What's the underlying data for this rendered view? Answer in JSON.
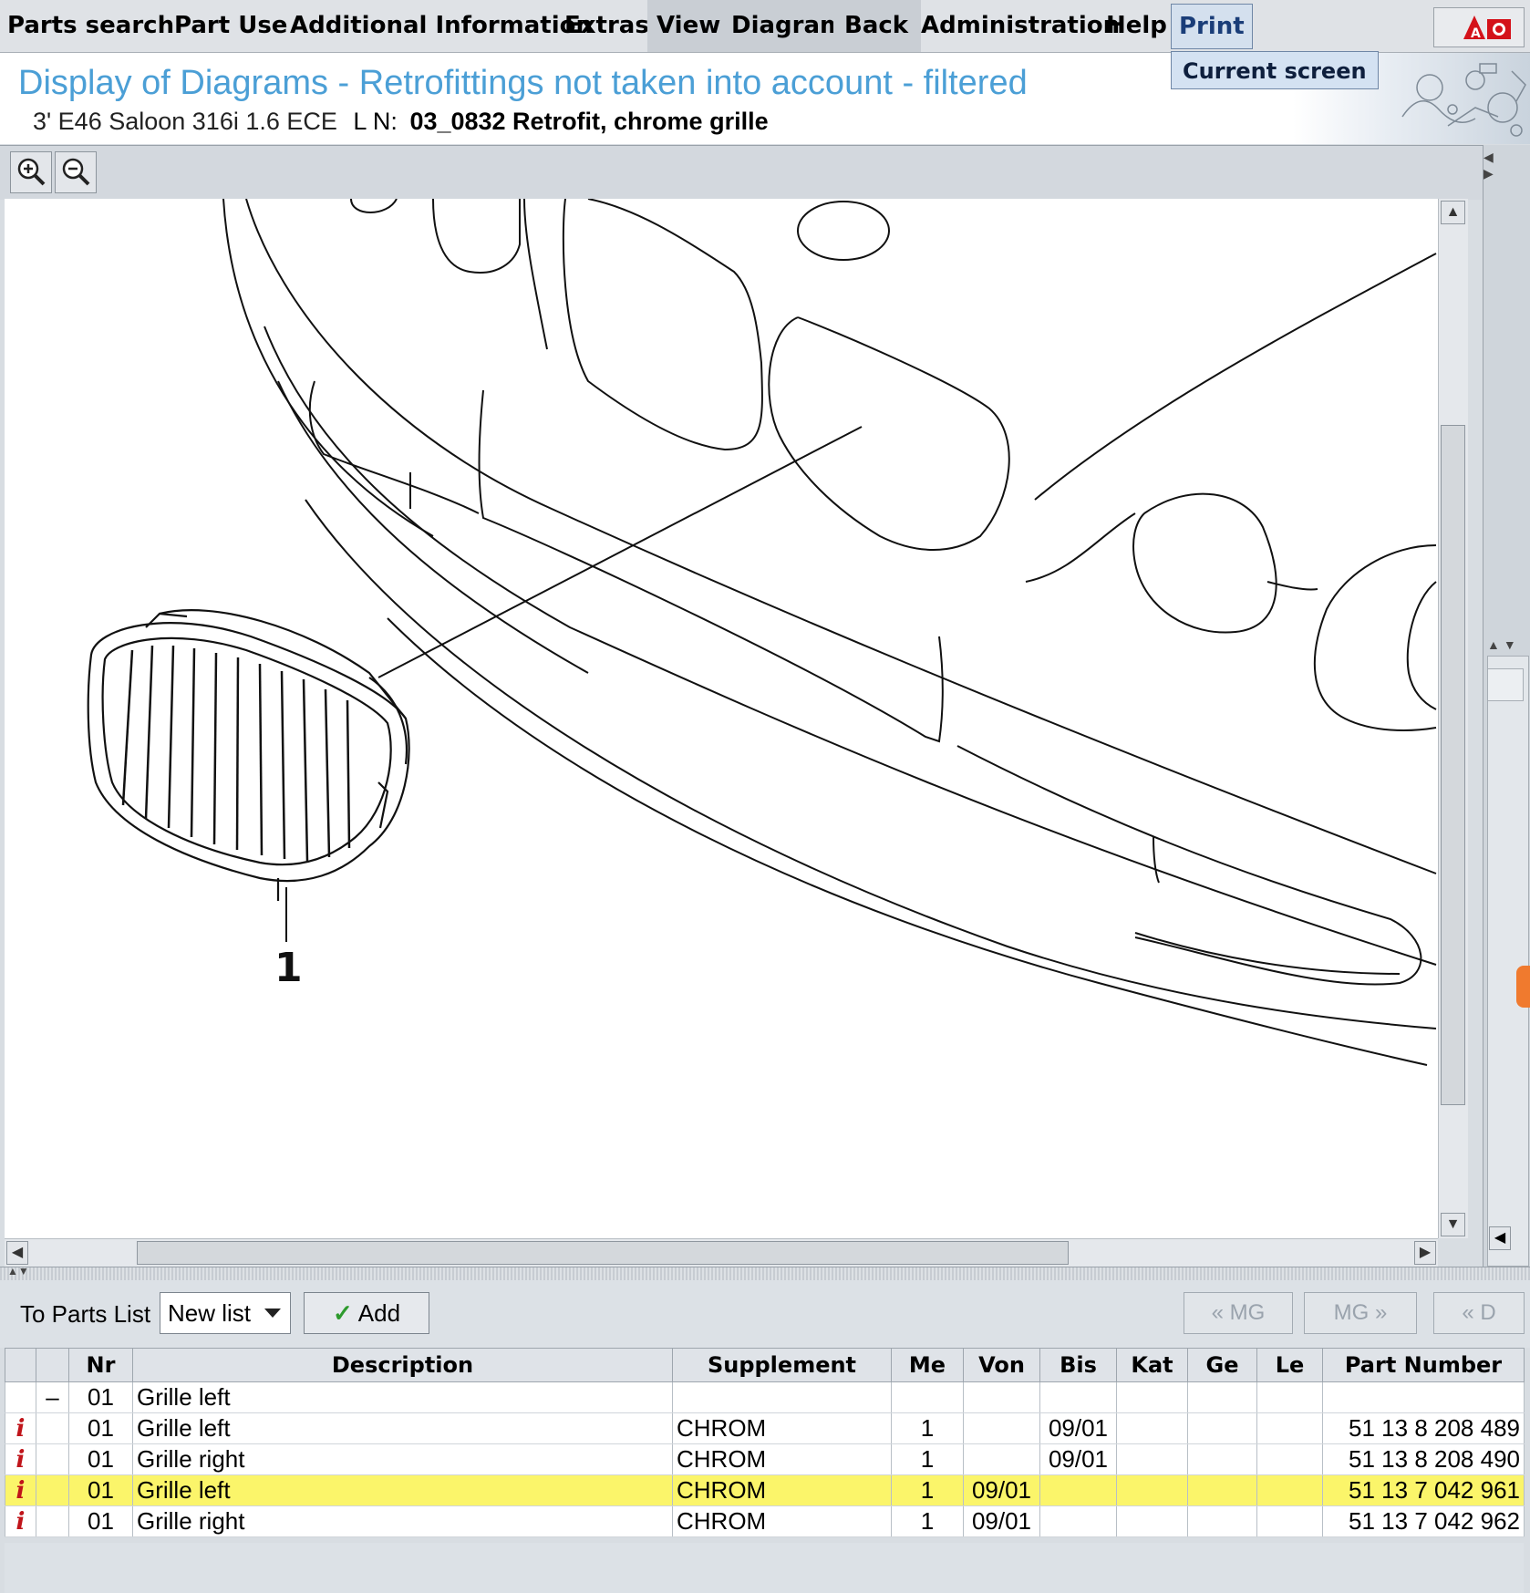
{
  "menu": {
    "items": [
      "Parts search",
      "Part Use",
      "Additional Information",
      "Extras",
      "View",
      "Diagram",
      "Back",
      "Administration",
      "Help",
      "Print"
    ],
    "print_dropdown": "Current screen"
  },
  "header": {
    "title": "Display of Diagrams - Retrofittings not taken into account - filtered",
    "model": "3' E46 Saloon 316i 1.6 ECE",
    "ln_label": "L N:",
    "ln_value": "03_0832 Retrofit, chrome grille"
  },
  "diagram": {
    "callout_number": "1",
    "zoom_in_icon": "zoom-in-icon",
    "zoom_out_icon": "zoom-out-icon"
  },
  "toolbar": {
    "to_parts_list_label": "To Parts List",
    "list_select_value": "New list",
    "add_label": "Add",
    "prev_mg_label": "« MG",
    "next_mg_label": "MG »",
    "prev_d_label": "« D"
  },
  "table": {
    "headers": [
      "",
      "",
      "Nr",
      "Description",
      "Supplement",
      "Me",
      "Von",
      "Bis",
      "Kat",
      "Ge",
      "Le",
      "Part Number"
    ],
    "rows": [
      {
        "info": "",
        "tree": "–",
        "nr": "01",
        "description": "Grille left",
        "supplement": "",
        "me": "",
        "von": "",
        "bis": "",
        "kat": "",
        "ge": "",
        "le": "",
        "part_number": ""
      },
      {
        "info": "i",
        "tree": "",
        "nr": "01",
        "description": "Grille left",
        "supplement": "CHROM",
        "me": "1",
        "von": "",
        "bis": "09/01",
        "kat": "",
        "ge": "",
        "le": "",
        "part_number": "51 13 8 208 489"
      },
      {
        "info": "i",
        "tree": "",
        "nr": "01",
        "description": "Grille right",
        "supplement": "CHROM",
        "me": "1",
        "von": "",
        "bis": "09/01",
        "kat": "",
        "ge": "",
        "le": "",
        "part_number": "51 13 8 208 490"
      },
      {
        "info": "i",
        "tree": "",
        "nr": "01",
        "description": "Grille left",
        "supplement": "CHROM",
        "me": "1",
        "von": "09/01",
        "bis": "",
        "kat": "",
        "ge": "",
        "le": "",
        "part_number": "51 13 7 042 961"
      },
      {
        "info": "i",
        "tree": "",
        "nr": "01",
        "description": "Grille right",
        "supplement": "CHROM",
        "me": "1",
        "von": "09/01",
        "bis": "",
        "kat": "",
        "ge": "",
        "le": "",
        "part_number": "51 13 7 042 962"
      }
    ],
    "selected_row": 3
  },
  "colors": {
    "title_blue": "#4b9fd6",
    "selected_row": "#fbf56a",
    "info_red": "#c0141a",
    "add_check_green": "#2d9a2d"
  }
}
